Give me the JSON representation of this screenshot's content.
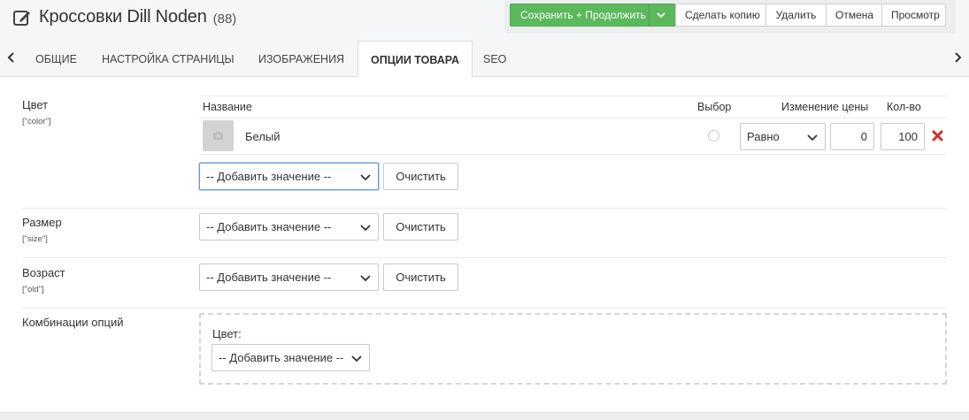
{
  "header": {
    "title": "Кроссовки Dill Noden",
    "count": "(88)",
    "icon": "edit-icon",
    "buttons": {
      "save_continue": "Сохранить + Продолжить",
      "make_copy": "Сделать копию",
      "delete": "Удалить",
      "cancel": "Отмена",
      "preview": "Просмотр"
    },
    "accent_color": "#5cb85c"
  },
  "tabs": {
    "items": [
      {
        "label": "Общие",
        "active": false
      },
      {
        "label": "Настройка страницы",
        "active": false
      },
      {
        "label": "Изображения",
        "active": false
      },
      {
        "label": "Опции товара",
        "active": true
      },
      {
        "label": "SEO",
        "active": false
      }
    ]
  },
  "options": [
    {
      "label": "Цвет",
      "code": "[\"color\"]",
      "columns": {
        "name": "Название",
        "choice": "Выбор",
        "price_change": "Изменение цены",
        "qty": "Кол-во"
      },
      "values": [
        {
          "name": "Белый",
          "price_mode": "Равно",
          "price": "0",
          "qty": "100"
        }
      ],
      "add_placeholder": "-- Добавить значение --",
      "clear_label": "Очистить"
    },
    {
      "label": "Размер",
      "code": "[\"size\"]",
      "add_placeholder": "-- Добавить значение --",
      "clear_label": "Очистить"
    },
    {
      "label": "Возраст",
      "code": "[\"old\"]",
      "add_placeholder": "-- Добавить значение --",
      "clear_label": "Очистить"
    }
  ],
  "combinations": {
    "label": "Комбинации опций",
    "field_label": "Цвет:",
    "add_placeholder": "-- Добавить значение --"
  }
}
